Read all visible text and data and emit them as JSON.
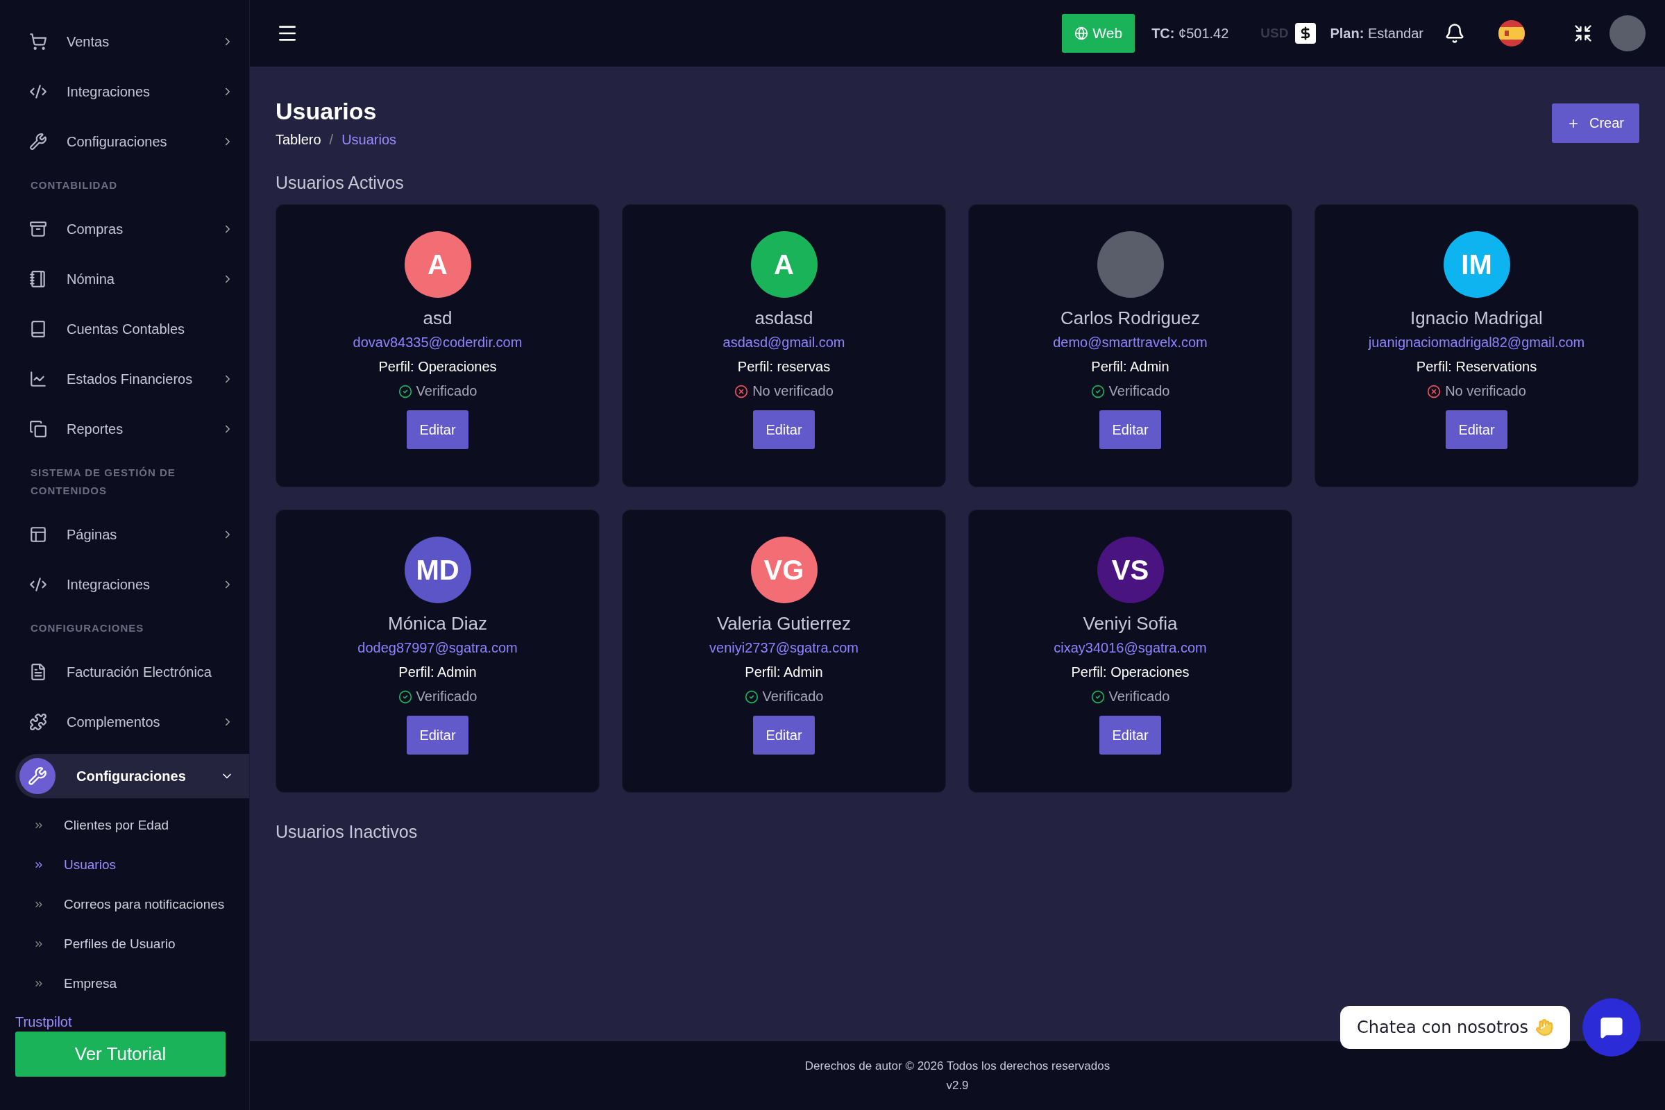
{
  "sidebar": {
    "groups": [
      {
        "items": [
          {
            "label": "Ventas",
            "expanded": false
          },
          {
            "label": "Integraciones",
            "expanded": false
          },
          {
            "label": "Configuraciones",
            "expanded": false
          }
        ]
      },
      {
        "heading": "CONTABILIDAD",
        "items": [
          {
            "label": "Compras",
            "expanded": false
          },
          {
            "label": "Nómina",
            "expanded": false
          },
          {
            "label": "Cuentas Contables"
          },
          {
            "label": "Estados Financieros",
            "expanded": false
          },
          {
            "label": "Reportes",
            "expanded": false
          }
        ]
      },
      {
        "heading": "SISTEMA DE GESTIÓN DE CONTENIDOS",
        "items": [
          {
            "label": "Páginas",
            "expanded": false
          },
          {
            "label": "Integraciones",
            "expanded": false
          }
        ]
      },
      {
        "heading": "CONFIGURACIONES",
        "items": [
          {
            "label": "Facturación Electrónica"
          },
          {
            "label": "Complementos",
            "expanded": false
          },
          {
            "label": "Configuraciones",
            "expanded": true,
            "selected": true,
            "children": [
              {
                "label": "Clientes por Edad",
                "selected": false
              },
              {
                "label": "Usuarios",
                "selected": true
              },
              {
                "label": "Correos para notificaciones",
                "selected": false
              },
              {
                "label": "Perfiles de Usuario",
                "selected": false
              },
              {
                "label": "Empresa",
                "selected": false
              }
            ]
          }
        ]
      }
    ],
    "trustpilot": "Trustpilot",
    "tutorial_button": "Ver Tutorial"
  },
  "header": {
    "web_button": "Web",
    "tc_label": "TC:",
    "tc_value": "¢501.42",
    "currency": "USD",
    "plan_label": "Plan:",
    "plan_value": "Estandar"
  },
  "page": {
    "title": "Usuarios",
    "breadcrumb_separator": "/",
    "breadcrumb": [
      {
        "label": "Tablero",
        "selected": false
      },
      {
        "label": "Usuarios",
        "selected": true
      }
    ],
    "create_button": "Crear"
  },
  "sections": [
    {
      "title": "Usuarios Activos",
      "users": [
        {
          "avatar": {
            "kind": "initials",
            "initials": "A",
            "color": "#f26d74"
          },
          "name": "asd",
          "email": "dovav84335@coderdir.com",
          "profile": "Perfil: Operaciones",
          "verified": true,
          "status": "Verificado",
          "button": "Editar"
        },
        {
          "avatar": {
            "kind": "initials",
            "initials": "A",
            "color": "#1bb35a"
          },
          "name": "asdasd",
          "email": "asdasd@gmail.com",
          "profile": "Perfil: reservas",
          "verified": false,
          "status": "No verificado",
          "button": "Editar"
        },
        {
          "avatar": {
            "kind": "photo"
          },
          "name": "Carlos Rodriguez",
          "email": "demo@smarttravelx.com",
          "profile": "Perfil: Admin",
          "verified": true,
          "status": "Verificado",
          "button": "Editar"
        },
        {
          "avatar": {
            "kind": "initials",
            "initials": "IM",
            "color": "#0db4f0"
          },
          "name": "Ignacio Madrigal",
          "email": "juanignaciomadrigal82@gmail.com",
          "profile": "Perfil: Reservations",
          "verified": false,
          "status": "No verificado",
          "button": "Editar"
        },
        {
          "avatar": {
            "kind": "initials",
            "initials": "MD",
            "color": "#5b55c8"
          },
          "name": "Mónica Diaz",
          "email": "dodeg87997@sgatra.com",
          "profile": "Perfil: Admin",
          "verified": true,
          "status": "Verificado",
          "button": "Editar"
        },
        {
          "avatar": {
            "kind": "initials",
            "initials": "VG",
            "color": "#f26d74"
          },
          "name": "Valeria Gutierrez",
          "email": "veniyi2737@sgatra.com",
          "profile": "Perfil: Admin",
          "verified": true,
          "status": "Verificado",
          "button": "Editar"
        },
        {
          "avatar": {
            "kind": "initials",
            "initials": "VS",
            "color": "#4a1480"
          },
          "name": "Veniyi Sofia",
          "email": "cixay34016@sgatra.com",
          "profile": "Perfil: Operaciones",
          "verified": true,
          "status": "Verificado",
          "button": "Editar"
        }
      ]
    },
    {
      "title": "Usuarios Inactivos"
    }
  ],
  "footer": {
    "copyright": "Derechos de autor © 2026 Todos los derechos reservados",
    "version": "v2.9"
  },
  "chat": {
    "label": "Chatea con nosotros"
  }
}
